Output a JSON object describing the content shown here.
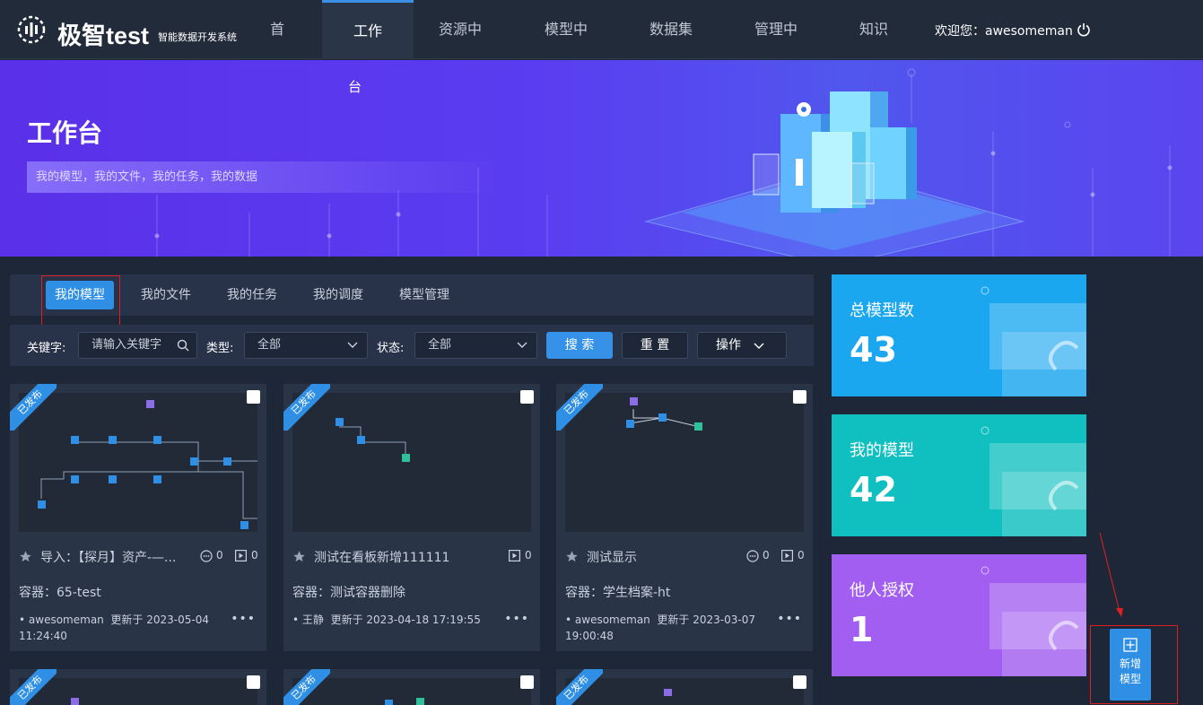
{
  "header": {
    "brand": "极智test",
    "brand_sub": "智能数据开发系统",
    "nav": [
      "首",
      "工作",
      "资源中",
      "模型中",
      "数据集",
      "管理中",
      "知识"
    ],
    "nav_wrap": "台",
    "welcome": "欢迎您：awesomeman"
  },
  "banner": {
    "title": "工作台",
    "subtitle": "我的模型，我的文件，我的任务，我的数据"
  },
  "tabs": [
    "我的模型",
    "我的文件",
    "我的任务",
    "我的调度",
    "模型管理"
  ],
  "filters": {
    "keyword_label": "关键字:",
    "keyword_placeholder": "请输入关键字",
    "type_label": "类型:",
    "type_value": "全部",
    "status_label": "状态:",
    "status_value": "全部",
    "search": "搜 索",
    "reset": "重 置",
    "ops": "操作"
  },
  "cards": [
    {
      "badge": "已发布",
      "title": "导入：【探月】资产-—...",
      "comments": "0",
      "runs": "0",
      "container": "容器：65-test",
      "user": "awesomeman",
      "updated": "更新于 2023-05-04 11:24:40"
    },
    {
      "badge": "已发布",
      "title": "测试在看板新增111111",
      "comments": "",
      "runs": "0",
      "container": "容器：测试容器删除",
      "user": "王静",
      "updated": "更新于 2023-04-18 17:19:55"
    },
    {
      "badge": "已发布",
      "title": "测试显示",
      "comments": "0",
      "runs": "0",
      "container": "容器：学生档案-ht",
      "user": "awesomeman",
      "updated": "更新于 2023-03-07 19:00:48"
    },
    {
      "badge": "已发布"
    },
    {
      "badge": "已发布"
    },
    {
      "badge": "已发布"
    }
  ],
  "stats": [
    {
      "label": "总模型数",
      "value": "43",
      "color": "#1aa7f0"
    },
    {
      "label": "我的模型",
      "value": "42",
      "color": "#10bfbf"
    },
    {
      "label": "他人授权",
      "value": "1",
      "color": "#a15ef0"
    }
  ],
  "add_model": {
    "line1": "新增",
    "line2": "模型"
  }
}
